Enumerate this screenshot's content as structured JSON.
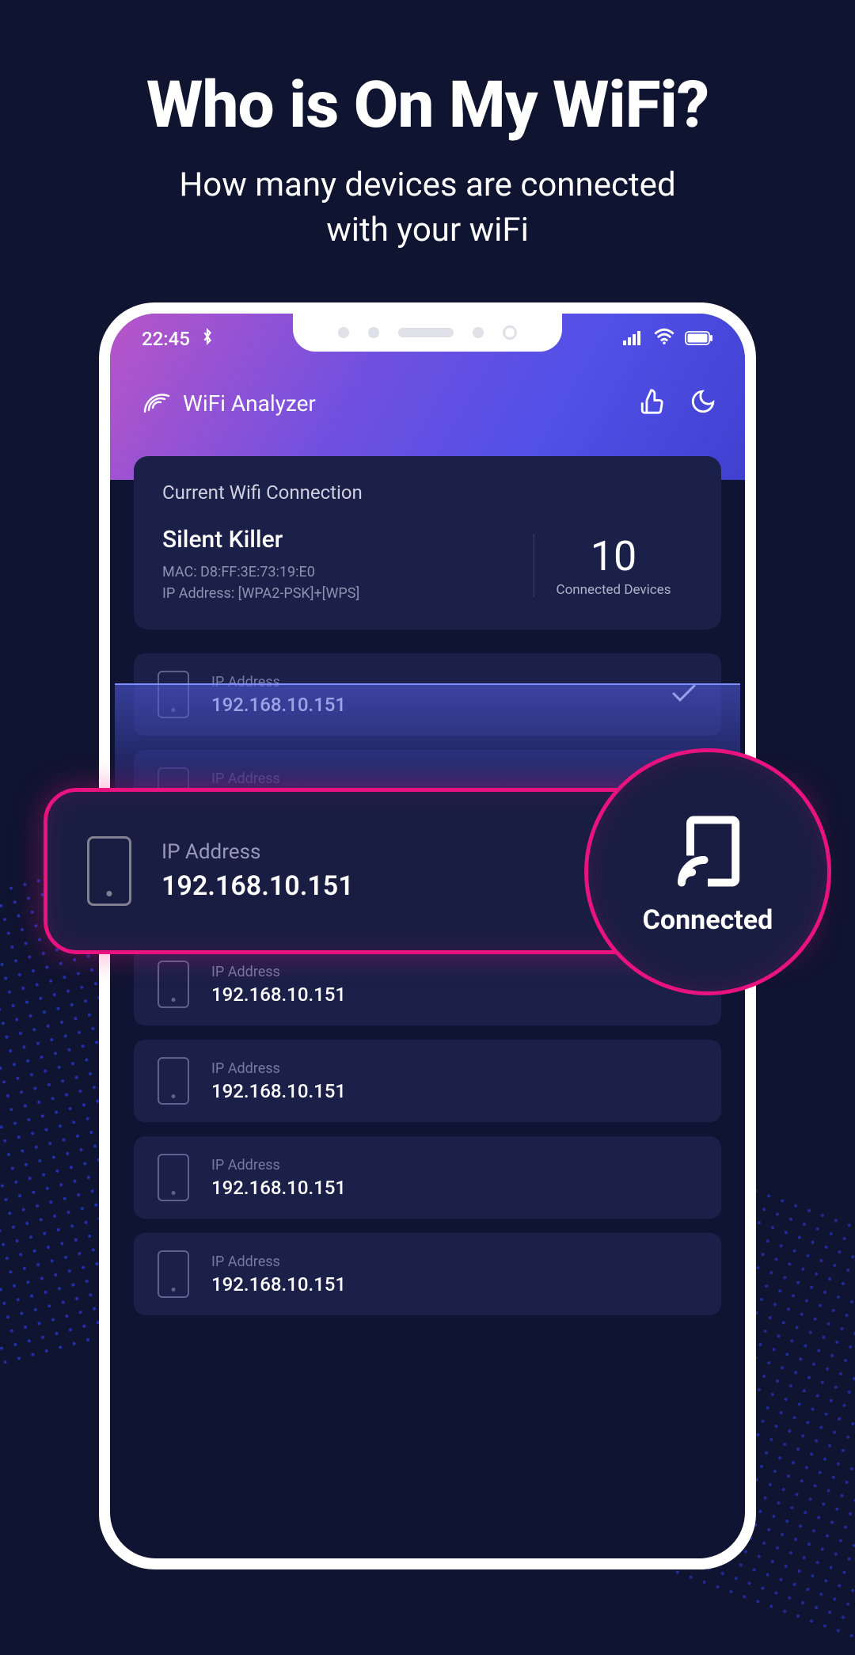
{
  "hero": {
    "title": "Who is On My WiFi?",
    "subtitle_l1": "How many devices are connected",
    "subtitle_l2": "with your wiFi"
  },
  "status": {
    "time": "22:45"
  },
  "header": {
    "app_name": "WiFi Analyzer"
  },
  "wifi": {
    "card_title": "Current Wifi Connection",
    "ssid": "Silent Killer",
    "mac_line": "MAC: D8:FF:3E:73:19:E0",
    "ip_line": "IP Address: [WPA2-PSK]+[WPS]",
    "count": "10",
    "count_label": "Connected Devices"
  },
  "devices": [
    {
      "label": "IP Address",
      "ip": "192.168.10.151",
      "checked": true
    },
    {
      "label": "IP Address",
      "ip": "192.168.10.151"
    },
    {
      "label": "IP Address",
      "ip": "192.168.10.151"
    },
    {
      "label": "IP Address",
      "ip": "192.168.10.151"
    },
    {
      "label": "IP Address",
      "ip": "192.168.10.151"
    },
    {
      "label": "IP Address",
      "ip": "192.168.10.151"
    },
    {
      "label": "IP Address",
      "ip": "192.168.10.151"
    }
  ],
  "highlight": {
    "label": "IP Address",
    "ip": "192.168.10.151",
    "badge": "Connected"
  }
}
